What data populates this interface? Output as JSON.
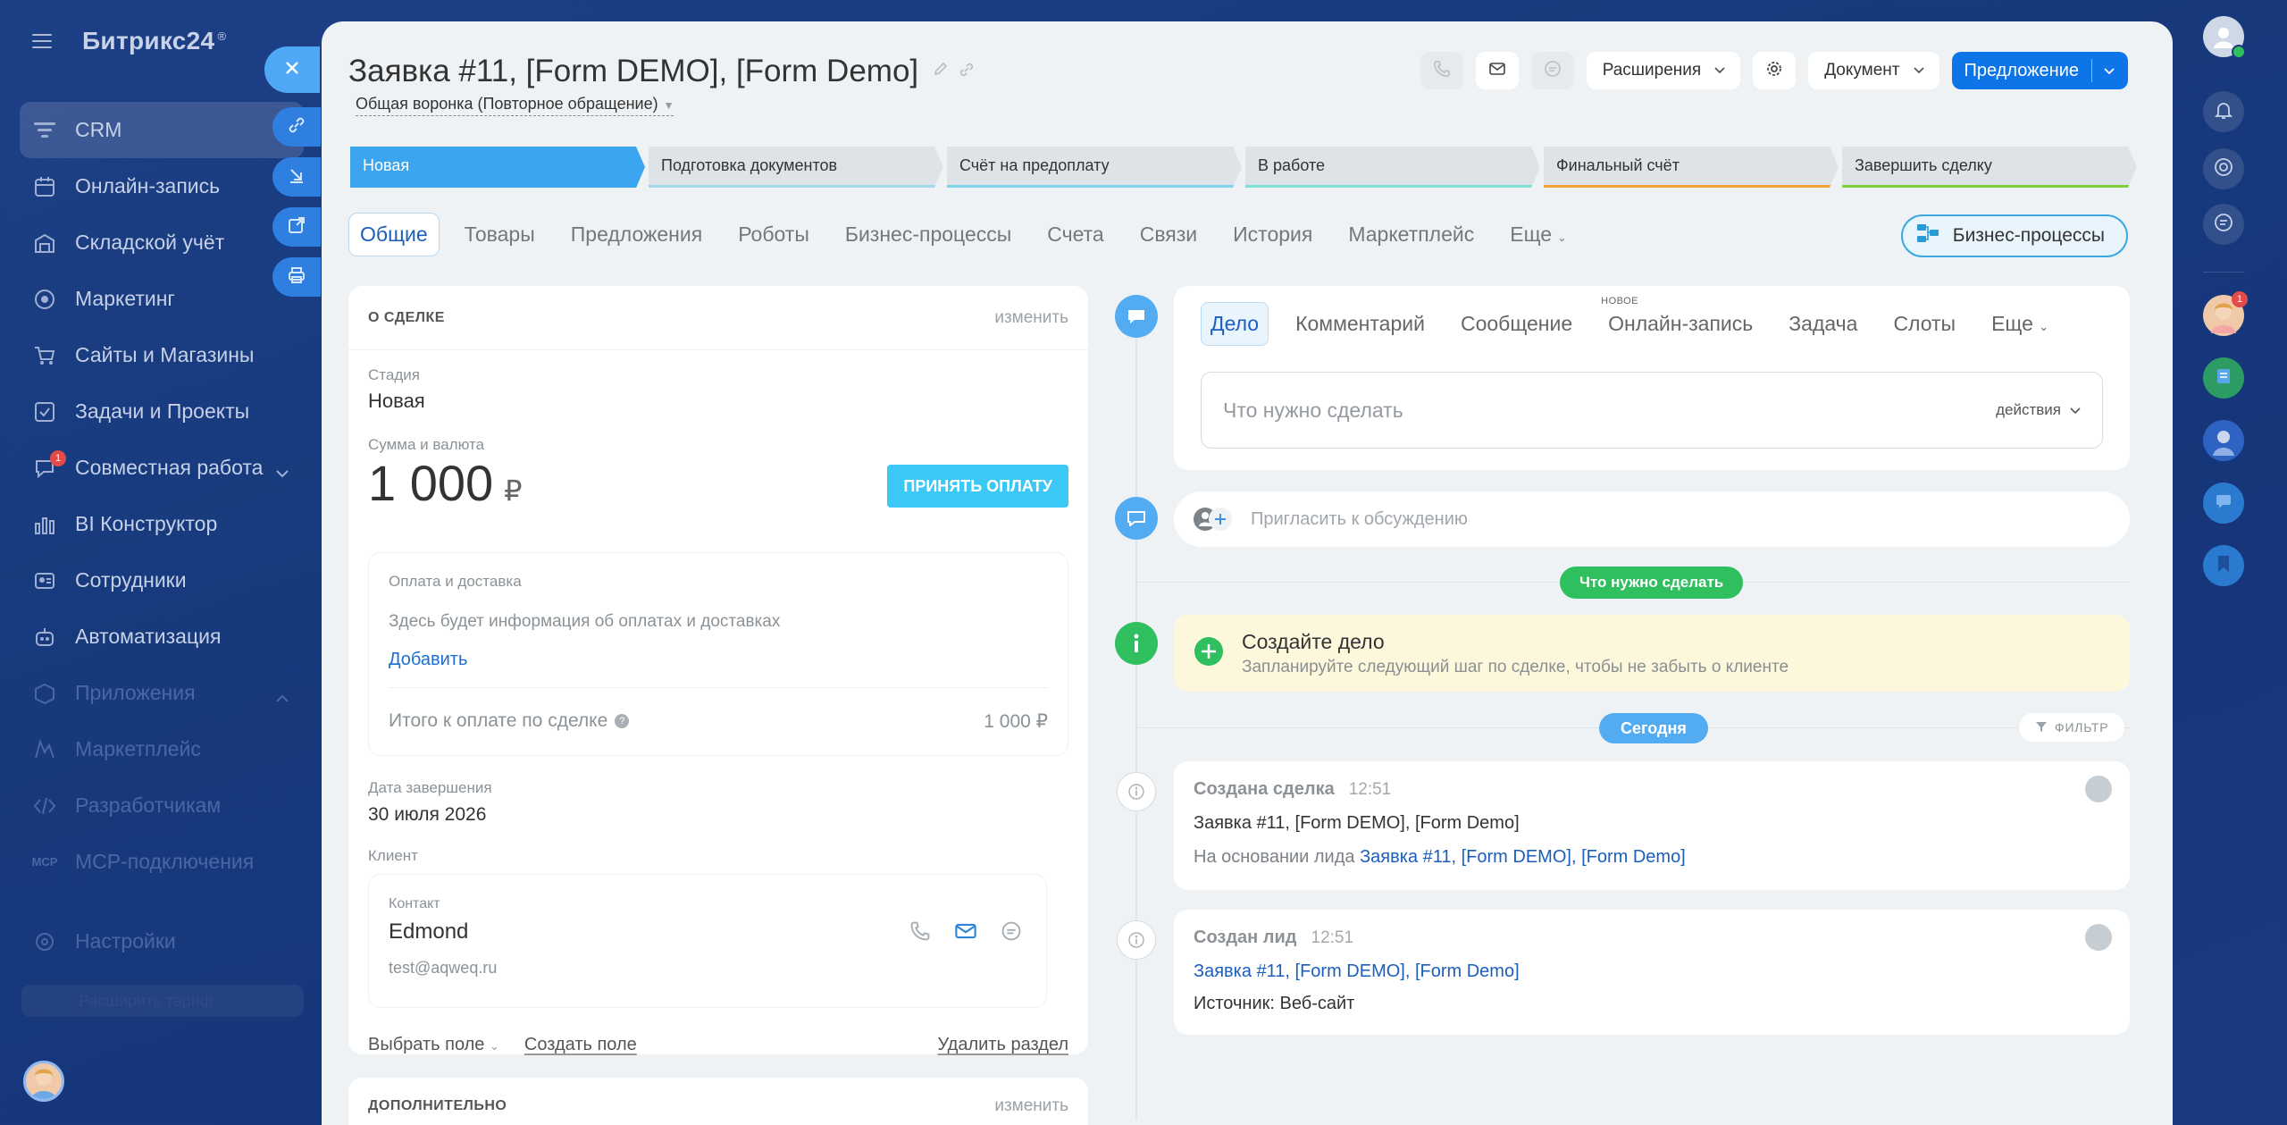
{
  "app": {
    "logo": "Битрикс24",
    "logo_mark": "®"
  },
  "sidebar": {
    "items": [
      {
        "label": "CRM",
        "icon": "funnel-icon"
      },
      {
        "label": "Онлайн-запись",
        "icon": "calendar-icon"
      },
      {
        "label": "Складской учёт",
        "icon": "warehouse-icon"
      },
      {
        "label": "Маркетинг",
        "icon": "target-icon"
      },
      {
        "label": "Сайты и Магазины",
        "icon": "cart-icon"
      },
      {
        "label": "Задачи и Проекты",
        "icon": "checkbox-icon"
      },
      {
        "label": "Совместная работа",
        "icon": "chat-icon",
        "badge": "1"
      },
      {
        "label": "BI Конструктор",
        "icon": "bars-icon"
      },
      {
        "label": "Сотрудники",
        "icon": "people-icon"
      },
      {
        "label": "Автоматизация",
        "icon": "robot-icon"
      },
      {
        "label": "Приложения",
        "icon": "box-icon"
      },
      {
        "label": "Маркетплейс",
        "icon": "grid-icon"
      },
      {
        "label": "Разработчикам",
        "icon": "code-icon"
      },
      {
        "label": "MCP-подключения",
        "icon": "mcp-icon"
      },
      {
        "label": "Настройки",
        "icon": "gear-icon"
      }
    ],
    "footer": "Расширить тариф"
  },
  "deal": {
    "title": "Заявка #11, [Form DEMO], [Form Demo]",
    "funnel": "Общая воронка (Повторное обращение)"
  },
  "toolbar": {
    "extensions": "Расширения",
    "document": "Документ",
    "offer": "Предложение"
  },
  "stages": [
    {
      "label": "Новая",
      "color": "#3ca5f0"
    },
    {
      "label": "Подготовка документов",
      "color": "#9fd9ea"
    },
    {
      "label": "Счёт на предоплату",
      "color": "#7fd3e6"
    },
    {
      "label": "В работе",
      "color": "#7fe0d7"
    },
    {
      "label": "Финальный счёт",
      "color": "#f3a33b"
    },
    {
      "label": "Завершить сделку",
      "color": "#7fcf3a"
    }
  ],
  "tabs": [
    "Общие",
    "Товары",
    "Предложения",
    "Роботы",
    "Бизнес-процессы",
    "Счета",
    "Связи",
    "История",
    "Маркетплейс",
    "Еще"
  ],
  "bp_button": "Бизнес-процессы",
  "about": {
    "heading": "О СДЕЛКЕ",
    "edit": "изменить",
    "stage_label": "Стадия",
    "stage_value": "Новая",
    "sum_label": "Сумма и валюта",
    "sum_value": "1 000",
    "currency": "₽",
    "pay_button": "ПРИНЯТЬ ОПЛАТУ",
    "payment_title": "Оплата и доставка",
    "payment_hint": "Здесь будет информация об оплатах и доставках",
    "payment_add": "Добавить",
    "total_label": "Итого к оплате по сделке",
    "total_value": "1 000 ₽",
    "close_label": "Дата завершения",
    "close_value": "30 июля 2026",
    "client_label": "Клиент",
    "contact_label": "Контакт",
    "contact_name": "Edmond",
    "contact_email": "test@aqweq.ru",
    "choose_field": "Выбрать поле",
    "create_field": "Создать поле",
    "delete_section": "Удалить раздел"
  },
  "extra": {
    "heading": "ДОПОЛНИТЕЛЬНО",
    "edit": "изменить"
  },
  "activity": {
    "tabs": [
      "Дело",
      "Комментарий",
      "Сообщение",
      "Онлайн-запись",
      "Задача",
      "Слоты",
      "Еще"
    ],
    "new_label": "НОВОЕ",
    "placeholder": "Что нужно сделать",
    "actions": "действия"
  },
  "invite": "Пригласить к обсуждению",
  "todo_pill": "Что нужно сделать",
  "create": {
    "title": "Создайте дело",
    "subtitle": "Запланируйте следующий шаг по сделке, чтобы не забыть о клиенте"
  },
  "today_pill": "Сегодня",
  "filter": "ФИЛЬТР",
  "history": [
    {
      "title": "Создана сделка",
      "time": "12:51",
      "line1": "Заявка #11, [Form DEMO], [Form Demo]",
      "line2_prefix": "На основании лида",
      "line2_link": "Заявка #11, [Form DEMO], [Form Demo]"
    },
    {
      "title": "Создан лид",
      "time": "12:51",
      "line1": "Заявка #11, [Form DEMO], [Form Demo]",
      "line2": "Источник: Веб-сайт"
    }
  ],
  "notifications_badge": "1"
}
